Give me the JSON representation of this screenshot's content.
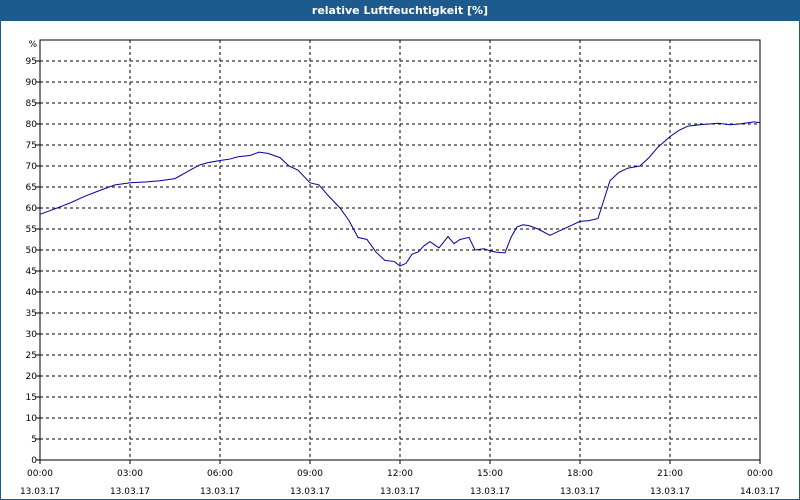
{
  "window": {
    "title": "relative Luftfeuchtigkeit [%]"
  },
  "colors": {
    "titlebar": "#1d5b8e",
    "series": "#0000a0",
    "grid": "#000000"
  },
  "chart_data": {
    "type": "line",
    "title": "relative Luftfeuchtigkeit [%]",
    "ylabel": "%",
    "ylim": [
      0,
      100
    ],
    "yticks": [
      0,
      5,
      10,
      15,
      20,
      25,
      30,
      35,
      40,
      45,
      50,
      55,
      60,
      65,
      70,
      75,
      80,
      85,
      90,
      95
    ],
    "xlim": [
      0,
      24
    ],
    "xticks": [
      {
        "x": 0,
        "time": "00:00",
        "date": "13.03.17"
      },
      {
        "x": 3,
        "time": "03:00",
        "date": "13.03.17"
      },
      {
        "x": 6,
        "time": "06:00",
        "date": "13.03.17"
      },
      {
        "x": 9,
        "time": "09:00",
        "date": "13.03.17"
      },
      {
        "x": 12,
        "time": "12:00",
        "date": "13.03.17"
      },
      {
        "x": 15,
        "time": "15:00",
        "date": "13.03.17"
      },
      {
        "x": 18,
        "time": "18:00",
        "date": "13.03.17"
      },
      {
        "x": 21,
        "time": "21:00",
        "date": "13.03.17"
      },
      {
        "x": 24,
        "time": "00:00",
        "date": "14.03.17"
      }
    ],
    "grid": true,
    "series": [
      {
        "x": [
          0,
          0.5,
          1,
          1.5,
          2,
          2.5,
          3,
          3.5,
          4,
          4.5,
          5,
          5.3,
          5.6,
          6,
          6.3,
          6.6,
          7,
          7.3,
          7.6,
          8,
          8.3,
          8.6,
          9,
          9.3,
          9.6,
          10,
          10.3,
          10.6,
          10.9,
          11.2,
          11.5,
          11.8,
          12,
          12.2,
          12.4,
          12.6,
          12.8,
          13,
          13.3,
          13.6,
          13.8,
          14,
          14.3,
          14.5,
          14.8,
          15,
          15.2,
          15.5,
          15.7,
          15.9,
          16.1,
          16.3,
          16.6,
          17,
          17.3,
          17.6,
          18,
          18.3,
          18.6,
          18.8,
          19,
          19.3,
          19.6,
          20,
          20.3,
          20.6,
          21,
          21.3,
          21.6,
          22,
          22.3,
          22.6,
          23,
          23.3,
          23.6,
          23.8,
          24
        ],
        "y": [
          58.5,
          59.8,
          61.2,
          62.8,
          64.2,
          65.5,
          66,
          66.2,
          66.5,
          67,
          69,
          70.2,
          70.8,
          71.3,
          71.6,
          72.2,
          72.5,
          73.3,
          73,
          72,
          70,
          69,
          66,
          65.5,
          63,
          60,
          57,
          53,
          52.5,
          49.5,
          47.5,
          47.3,
          46.2,
          46.8,
          49,
          49.5,
          51,
          52,
          50.5,
          53.2,
          51.5,
          52.5,
          53,
          50,
          50.3,
          49.8,
          49.5,
          49.3,
          53,
          55.5,
          56,
          55.8,
          55,
          53.5,
          54.5,
          55.5,
          56.8,
          57,
          57.5,
          62,
          66.5,
          68.5,
          69.5,
          70,
          72,
          74.5,
          77,
          78.5,
          79.5,
          79.8,
          80,
          80.2,
          79.8,
          80,
          80.3,
          80.5,
          80.3
        ]
      }
    ]
  }
}
